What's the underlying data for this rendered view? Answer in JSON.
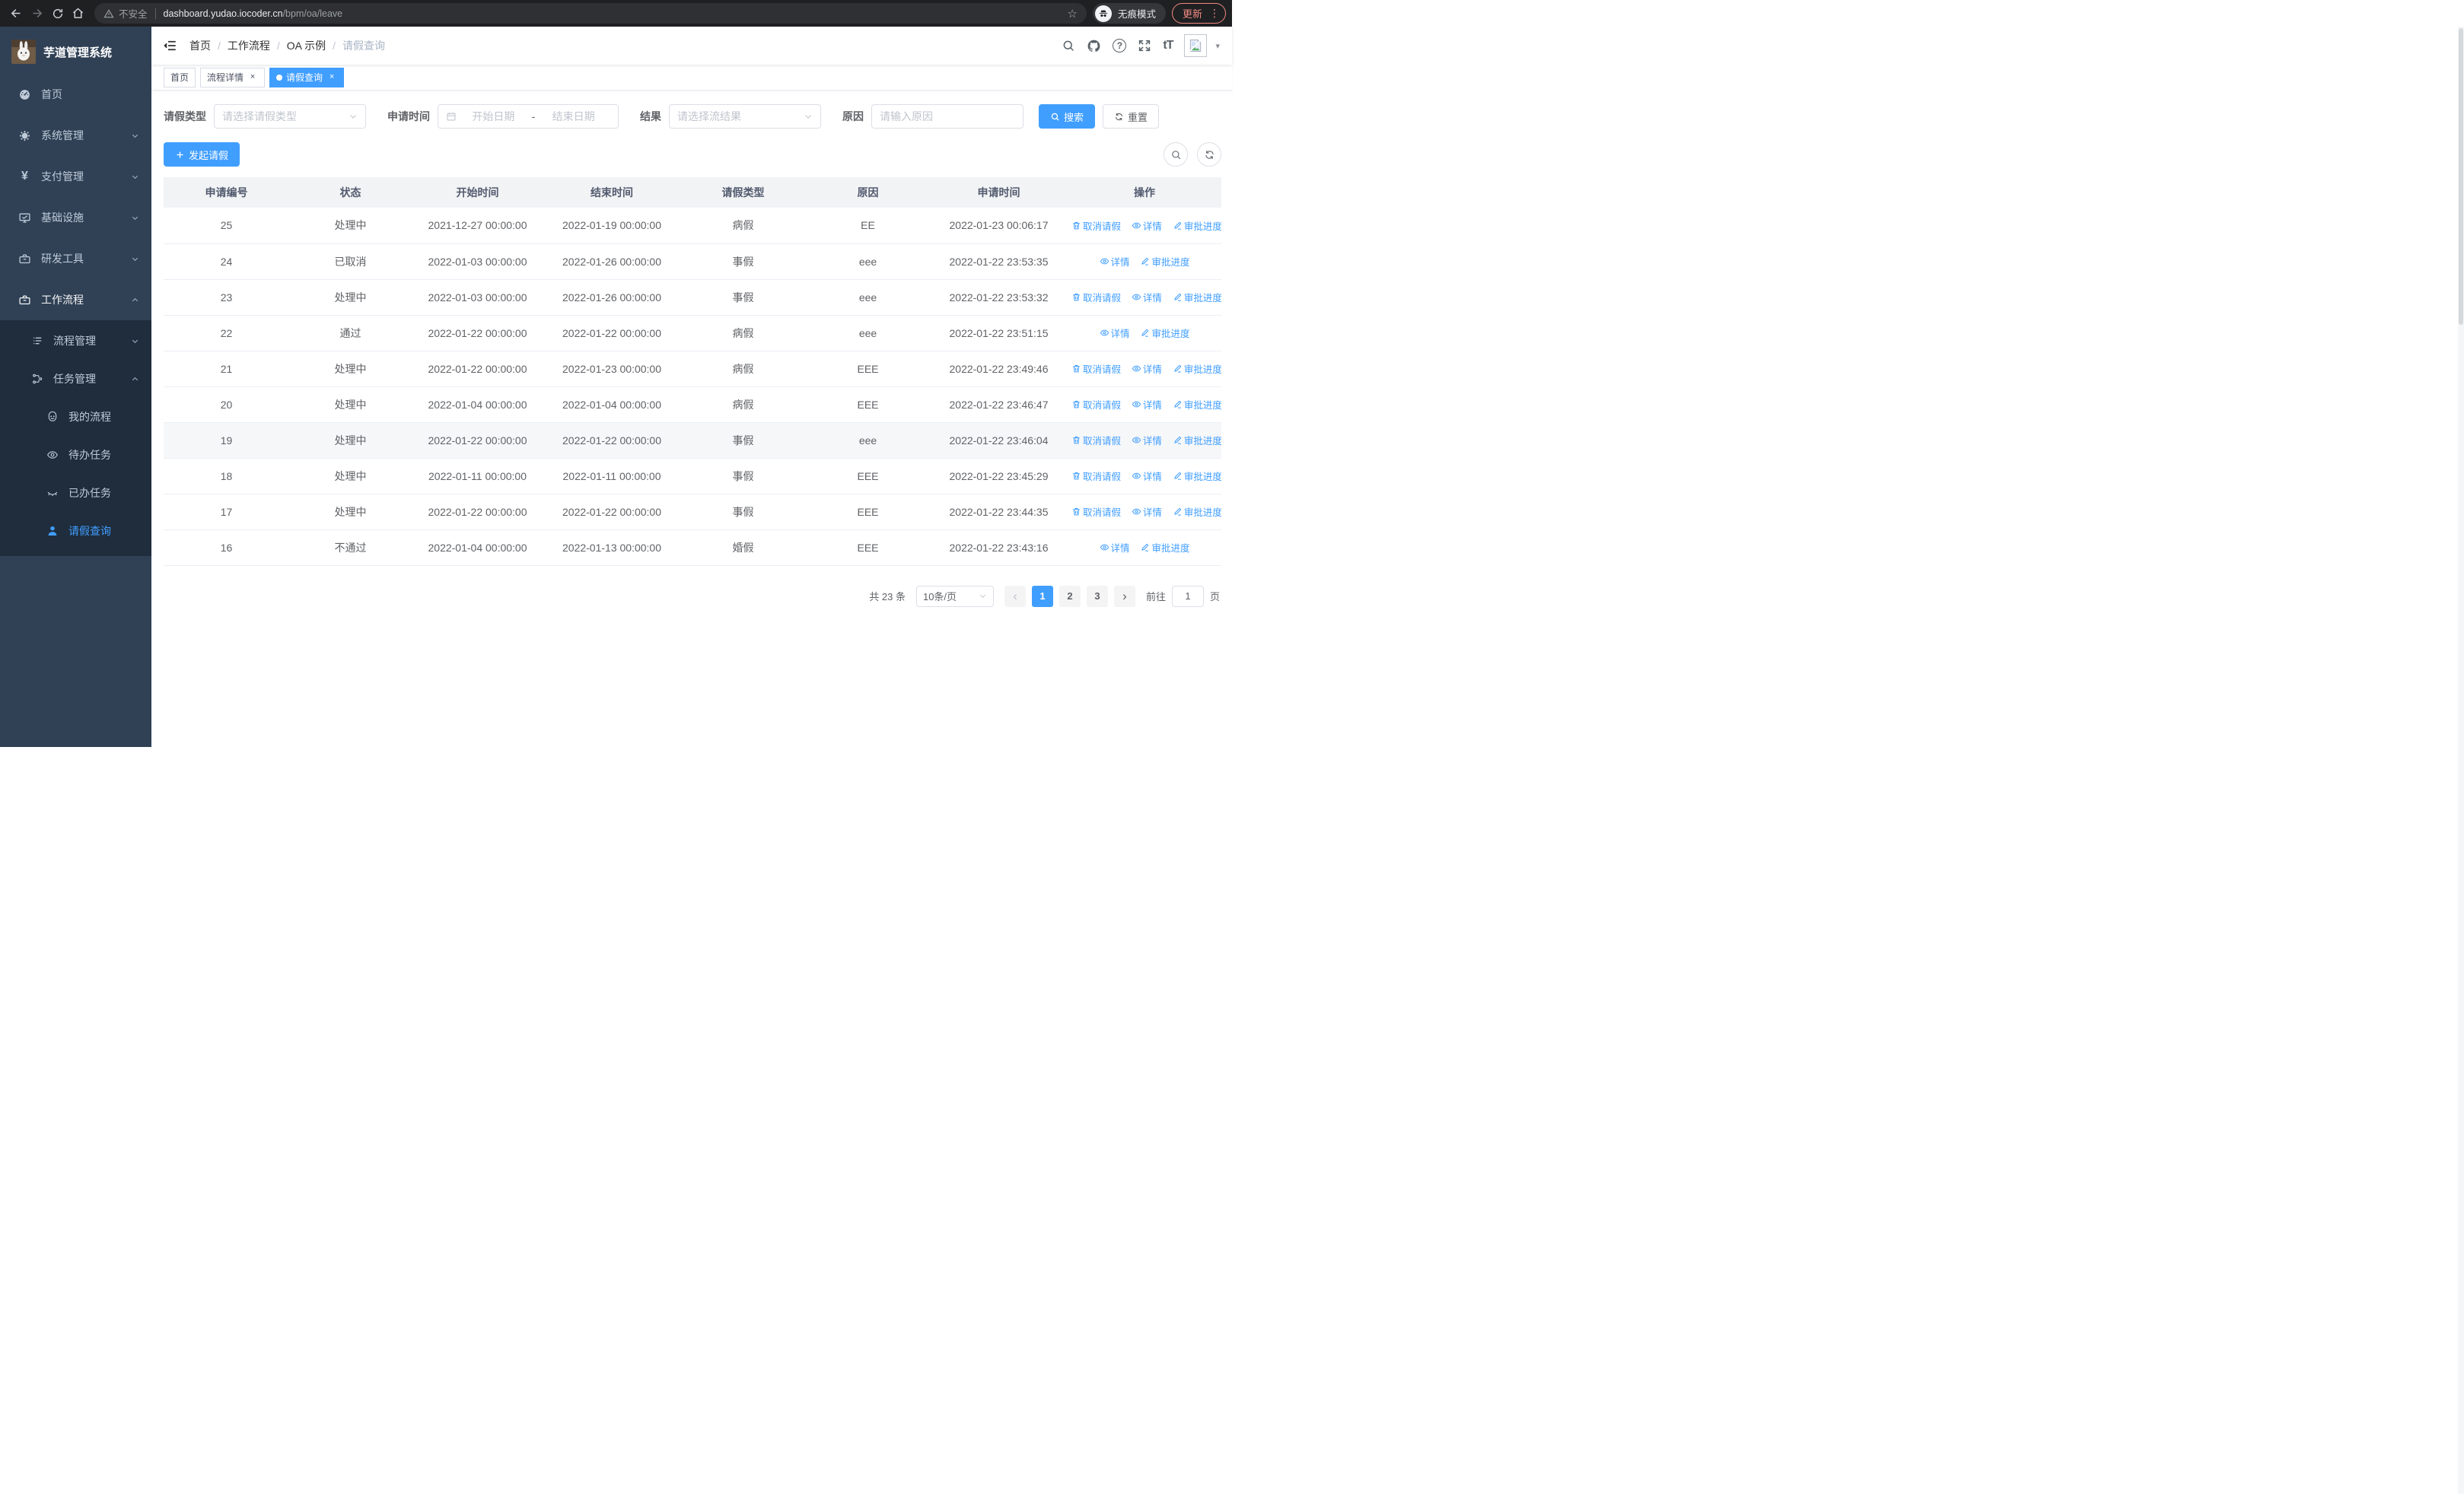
{
  "browser": {
    "security_label": "不安全",
    "url_host": "dashboard.yudao.iocoder.cn",
    "url_path": "/bpm/oa/leave",
    "incognito_label": "无痕模式",
    "update_label": "更新"
  },
  "glyphs": {
    "star": "☆",
    "more_vert": "⋮",
    "caret_down": "▾",
    "separator": "/",
    "close": "×",
    "question": "?",
    "font_size": "tT",
    "yen": "¥",
    "prev_arrow": "‹",
    "next_arrow": "›"
  },
  "sidebar": {
    "title": "芋道管理系统",
    "items": [
      {
        "label": "首页"
      },
      {
        "label": "系统管理"
      },
      {
        "label": "支付管理"
      },
      {
        "label": "基础设施"
      },
      {
        "label": "研发工具"
      },
      {
        "label": "工作流程"
      },
      {
        "label": "流程管理"
      },
      {
        "label": "任务管理"
      },
      {
        "label": "我的流程"
      },
      {
        "label": "待办任务"
      },
      {
        "label": "已办任务"
      },
      {
        "label": "请假查询"
      }
    ]
  },
  "header": {
    "breadcrumb": [
      "首页",
      "工作流程",
      "OA 示例",
      "请假查询"
    ]
  },
  "tabs": [
    {
      "label": "首页"
    },
    {
      "label": "流程详情"
    },
    {
      "label": "请假查询"
    }
  ],
  "filters": {
    "leave_type_label": "请假类型",
    "leave_type_placeholder": "请选择请假类型",
    "apply_time_label": "申请时间",
    "date_start_placeholder": "开始日期",
    "date_separator": "-",
    "date_end_placeholder": "结束日期",
    "result_label": "结果",
    "result_placeholder": "请选择流结果",
    "reason_label": "原因",
    "reason_placeholder": "请输入原因",
    "search_label": "搜索",
    "reset_label": "重置"
  },
  "toolbar": {
    "create_label": "发起请假"
  },
  "table": {
    "columns": [
      "申请编号",
      "状态",
      "开始时间",
      "结束时间",
      "请假类型",
      "原因",
      "申请时间",
      "操作"
    ],
    "action_labels": {
      "cancel": "取消请假",
      "detail": "详情",
      "progress": "审批进度"
    },
    "rows": [
      {
        "id": "25",
        "status": "处理中",
        "start": "2021-12-27 00:00:00",
        "end": "2022-01-19 00:00:00",
        "type": "病假",
        "reason": "EE",
        "applied": "2022-01-23 00:06:17",
        "cancel": true,
        "highlight": false
      },
      {
        "id": "24",
        "status": "已取消",
        "start": "2022-01-03 00:00:00",
        "end": "2022-01-26 00:00:00",
        "type": "事假",
        "reason": "eee",
        "applied": "2022-01-22 23:53:35",
        "cancel": false,
        "highlight": false
      },
      {
        "id": "23",
        "status": "处理中",
        "start": "2022-01-03 00:00:00",
        "end": "2022-01-26 00:00:00",
        "type": "事假",
        "reason": "eee",
        "applied": "2022-01-22 23:53:32",
        "cancel": true,
        "highlight": false
      },
      {
        "id": "22",
        "status": "通过",
        "start": "2022-01-22 00:00:00",
        "end": "2022-01-22 00:00:00",
        "type": "病假",
        "reason": "eee",
        "applied": "2022-01-22 23:51:15",
        "cancel": false,
        "highlight": false
      },
      {
        "id": "21",
        "status": "处理中",
        "start": "2022-01-22 00:00:00",
        "end": "2022-01-23 00:00:00",
        "type": "病假",
        "reason": "EEE",
        "applied": "2022-01-22 23:49:46",
        "cancel": true,
        "highlight": false
      },
      {
        "id": "20",
        "status": "处理中",
        "start": "2022-01-04 00:00:00",
        "end": "2022-01-04 00:00:00",
        "type": "病假",
        "reason": "EEE",
        "applied": "2022-01-22 23:46:47",
        "cancel": true,
        "highlight": false
      },
      {
        "id": "19",
        "status": "处理中",
        "start": "2022-01-22 00:00:00",
        "end": "2022-01-22 00:00:00",
        "type": "事假",
        "reason": "eee",
        "applied": "2022-01-22 23:46:04",
        "cancel": true,
        "highlight": true
      },
      {
        "id": "18",
        "status": "处理中",
        "start": "2022-01-11 00:00:00",
        "end": "2022-01-11 00:00:00",
        "type": "事假",
        "reason": "EEE",
        "applied": "2022-01-22 23:45:29",
        "cancel": true,
        "highlight": false
      },
      {
        "id": "17",
        "status": "处理中",
        "start": "2022-01-22 00:00:00",
        "end": "2022-01-22 00:00:00",
        "type": "事假",
        "reason": "EEE",
        "applied": "2022-01-22 23:44:35",
        "cancel": true,
        "highlight": false
      },
      {
        "id": "16",
        "status": "不通过",
        "start": "2022-01-04 00:00:00",
        "end": "2022-01-13 00:00:00",
        "type": "婚假",
        "reason": "EEE",
        "applied": "2022-01-22 23:43:16",
        "cancel": false,
        "highlight": false
      }
    ]
  },
  "pagination": {
    "total": "共 23 条",
    "page_size": "10条/页",
    "pages": [
      "1",
      "2",
      "3"
    ],
    "active_page": "1",
    "goto_label": "前往",
    "goto_value": "1",
    "page_label": "页"
  }
}
